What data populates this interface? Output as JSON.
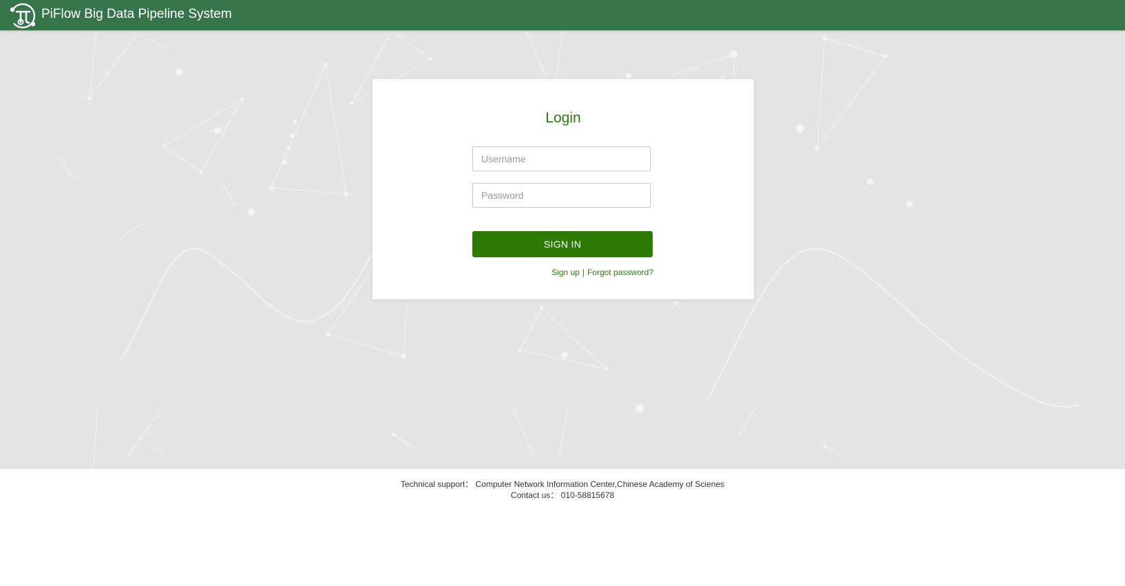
{
  "header": {
    "title": "PiFlow Big Data Pipeline System",
    "logo_icon": "pi-logo-icon",
    "background_color": "#36744a"
  },
  "login": {
    "title": "Login",
    "username_placeholder": "Username",
    "username_value": "",
    "password_placeholder": "Password",
    "password_value": "",
    "signin_label": "SIGN IN",
    "signup_label": "Sign up",
    "separator": "|",
    "forgot_label": "Forgot password?",
    "accent_color": "#2e7a06"
  },
  "footer": {
    "support_label": "Technical support：",
    "support_value": "Computer Network Information Center,Chinese Academy of Scienes",
    "contact_label": "Contact us：",
    "contact_value": "010-58815678"
  }
}
